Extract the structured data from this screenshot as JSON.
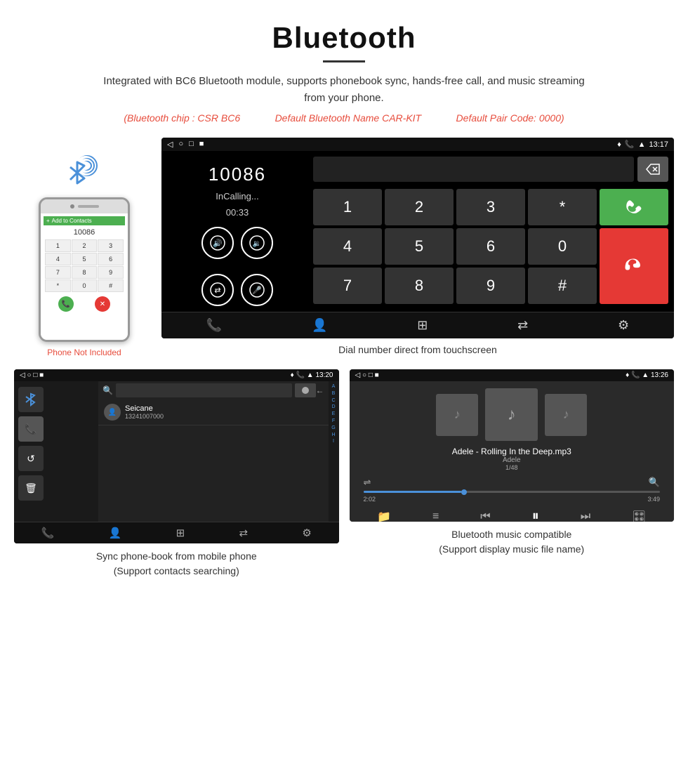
{
  "header": {
    "title": "Bluetooth",
    "subtitle": "Integrated with BC6 Bluetooth module, supports phonebook sync, hands-free call, and music streaming from your phone.",
    "chip_info": {
      "chip": "(Bluetooth chip : CSR BC6",
      "name": "Default Bluetooth Name CAR-KIT",
      "code": "Default Pair Code: 0000)"
    }
  },
  "phone_section": {
    "not_included": "Phone Not Included"
  },
  "dial_screen": {
    "status_bar": {
      "back": "◁",
      "home": "○",
      "square": "□",
      "menu": "■",
      "location": "♦",
      "phone": "📞",
      "wifi": "▲",
      "time": "13:17"
    },
    "number": "10086",
    "status": "InCalling...",
    "timer": "00:33",
    "keys": [
      "1",
      "2",
      "3",
      "*",
      "4",
      "5",
      "6",
      "0",
      "7",
      "8",
      "9",
      "#"
    ],
    "caption": "Dial number direct from touchscreen"
  },
  "phonebook_screen": {
    "status_bar": {
      "time": "13:20"
    },
    "contact": {
      "name": "Seicane",
      "number": "13241007000"
    },
    "letters": [
      "A",
      "B",
      "C",
      "D",
      "E",
      "F",
      "G",
      "H",
      "I"
    ],
    "caption_line1": "Sync phone-book from mobile phone",
    "caption_line2": "(Support contacts searching)"
  },
  "music_screen": {
    "status_bar": {
      "time": "13:26"
    },
    "track_name": "Adele - Rolling In the Deep.mp3",
    "artist": "Adele",
    "count": "1/48",
    "time_current": "2:02",
    "time_total": "3:49",
    "caption_line1": "Bluetooth music compatible",
    "caption_line2": "(Support display music file name)"
  },
  "icons": {
    "bluetooth": "ᛒ",
    "phone_green": "📞",
    "phone_red": "📵",
    "volume_up": "🔊",
    "volume_down": "🔉",
    "transfer": "⇄",
    "mic": "🎤",
    "music_note": "♪",
    "shuffle": "⇌",
    "prev": "⏮",
    "play": "⏸",
    "next": "⏭",
    "equalizer": "≡"
  }
}
